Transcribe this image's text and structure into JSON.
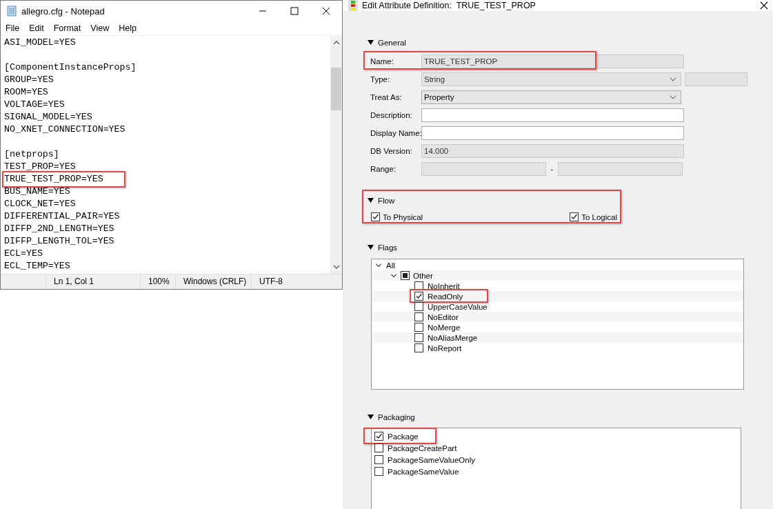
{
  "notepad": {
    "title": "allegro.cfg - Notepad",
    "menu": [
      "File",
      "Edit",
      "Format",
      "View",
      "Help"
    ],
    "blocks": [
      [
        {
          "text": "ASI_MODEL=YES",
          "highlighted": false
        }
      ],
      [
        {
          "text": "[ComponentInstanceProps]",
          "highlighted": false
        },
        {
          "text": "GROUP=YES",
          "highlighted": false
        },
        {
          "text": "ROOM=YES",
          "highlighted": false
        },
        {
          "text": "VOLTAGE=YES",
          "highlighted": false
        },
        {
          "text": "SIGNAL_MODEL=YES",
          "highlighted": false
        },
        {
          "text": "NO_XNET_CONNECTION=YES",
          "highlighted": false
        }
      ],
      [
        {
          "text": "[netprops]",
          "highlighted": false
        },
        {
          "text": "TEST_PROP=YES",
          "highlighted": false
        },
        {
          "text": "TRUE_TEST_PROP=YES",
          "highlighted": true
        },
        {
          "text": "BUS_NAME=YES",
          "highlighted": false
        },
        {
          "text": "CLOCK_NET=YES",
          "highlighted": false
        },
        {
          "text": "DIFFERENTIAL_PAIR=YES",
          "highlighted": false
        },
        {
          "text": "DIFFP_2ND_LENGTH=YES",
          "highlighted": false
        },
        {
          "text": "DIFFP_LENGTH_TOL=YES",
          "highlighted": false
        },
        {
          "text": "ECL=YES",
          "highlighted": false
        },
        {
          "text": "ECL_TEMP=YES",
          "highlighted": false
        }
      ]
    ],
    "status": [
      "Ln 1, Col 1",
      "100%",
      "Windows (CRLF)",
      "UTF-8"
    ]
  },
  "dialog": {
    "title": "Edit Attribute Definition:  TRUE_TEST_PROP",
    "general": {
      "title": "General",
      "expanded": true,
      "fields": [
        {
          "label": "Name:",
          "kind": "text",
          "value": "TRUE_TEST_PROP",
          "disabled": true,
          "highlighted": true
        },
        {
          "label": "Type:",
          "kind": "select",
          "value": "String",
          "disabled": true,
          "highlighted": false,
          "extra_field": true
        },
        {
          "label": "Treat As:",
          "kind": "select",
          "value": "Property",
          "disabled": false,
          "highlighted": false,
          "extra_field": false
        },
        {
          "label": "Description:",
          "kind": "text",
          "disabled": false,
          "highlighted": false
        },
        {
          "label": "Display Name:",
          "kind": "text",
          "disabled": false,
          "highlighted": false
        },
        {
          "label": "DB Version:",
          "kind": "text",
          "value": "14.000",
          "disabled": true,
          "highlighted": false
        },
        {
          "label": "Range:",
          "kind": "range",
          "separator": "-",
          "disabled": true,
          "highlighted": false
        }
      ]
    },
    "flow": {
      "title": "Flow",
      "expanded": true,
      "highlighted": true,
      "options": [
        {
          "label": "To Physical",
          "checked": true
        },
        {
          "label": "To Logical",
          "checked": true
        }
      ]
    },
    "flags": {
      "title": "Flags",
      "expanded": true,
      "tree": [
        {
          "label": "All",
          "expanded": true,
          "children": [
            {
              "label": "Other",
              "expanded": true,
              "partial": true,
              "children": [
                {
                  "label": "NoInherit",
                  "checked": false,
                  "highlighted": false
                },
                {
                  "label": "ReadOnly",
                  "checked": true,
                  "highlighted": true
                },
                {
                  "label": "UpperCaseValue",
                  "checked": false,
                  "highlighted": false
                },
                {
                  "label": "NoEditor",
                  "checked": false,
                  "highlighted": false
                },
                {
                  "label": "NoMerge",
                  "checked": false,
                  "highlighted": false
                },
                {
                  "label": "NoAliasMerge",
                  "checked": false,
                  "highlighted": false
                },
                {
                  "label": "NoReport",
                  "checked": false,
                  "highlighted": false
                }
              ]
            }
          ]
        }
      ]
    },
    "packaging": {
      "title": "Packaging",
      "expanded": true,
      "items": [
        {
          "label": "Package",
          "checked": true,
          "highlighted": true
        },
        {
          "label": "PackageCreatePart",
          "checked": false,
          "highlighted": false
        },
        {
          "label": "PackageSameValueOnly",
          "checked": false,
          "highlighted": false
        },
        {
          "label": "PackageSameValue",
          "checked": false,
          "highlighted": false
        }
      ]
    }
  }
}
